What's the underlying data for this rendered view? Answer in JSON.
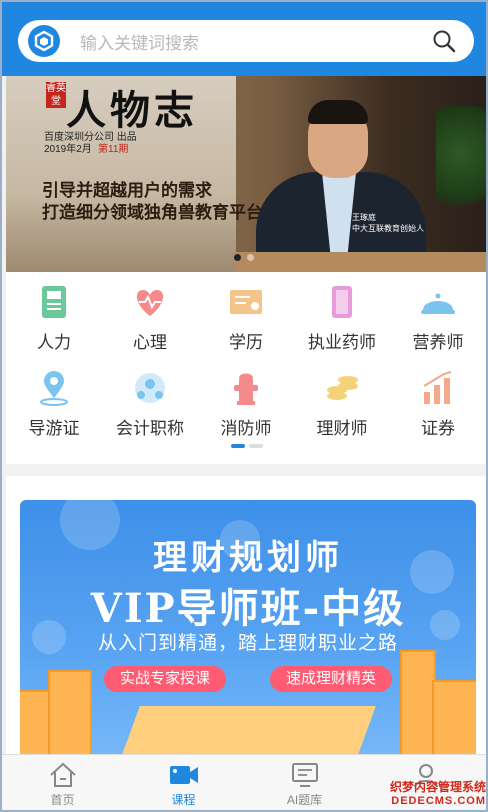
{
  "search": {
    "placeholder": "输入关键词搜索"
  },
  "banner": {
    "badge": "睿英堂",
    "brand": "人物志",
    "org": "百度深圳分公司 出品",
    "date": "2019年2月",
    "issue": "第11期",
    "slogan_line1": "引导并超越用户的需求",
    "slogan_line2": "打造细分领域独角兽教育平台",
    "person_name": "王琢庭",
    "person_title": "中大互联教育创始人",
    "slide_count": 2,
    "active_slide": 1
  },
  "categories": [
    {
      "label": "人力",
      "icon": "hr-book-icon",
      "color": "#6cc79a"
    },
    {
      "label": "心理",
      "icon": "heartbeat-icon",
      "color": "#f58a8a"
    },
    {
      "label": "学历",
      "icon": "certificate-icon",
      "color": "#f4c48a"
    },
    {
      "label": "执业药师",
      "icon": "medicine-box-icon",
      "color": "#e99ad8"
    },
    {
      "label": "营养师",
      "icon": "food-cover-icon",
      "color": "#7cc4f0"
    },
    {
      "label": "导游证",
      "icon": "location-pin-icon",
      "color": "#7cc4f0"
    },
    {
      "label": "会计职称",
      "icon": "network-icon",
      "color": "#7cc4f0"
    },
    {
      "label": "消防师",
      "icon": "fire-hydrant-icon",
      "color": "#f58a8a"
    },
    {
      "label": "理财师",
      "icon": "coins-icon",
      "color": "#f4d27a"
    },
    {
      "label": "证券",
      "icon": "bar-chart-icon",
      "color": "#f4a98a"
    }
  ],
  "category_pager": {
    "pages": 2,
    "active": 1
  },
  "promo": {
    "title": "理财规划师",
    "subtitle": "VIP导师班-中级",
    "tagline": "从入门到精通，踏上理财职业之路",
    "pill_left": "实战专家授课",
    "pill_right": "速成理财精英"
  },
  "tabbar": {
    "items": [
      {
        "label": "首页",
        "icon": "home-icon",
        "active": false
      },
      {
        "label": "课程",
        "icon": "video-icon",
        "active": true
      },
      {
        "label": "AI题库",
        "icon": "monitor-icon",
        "active": false
      },
      {
        "label": "",
        "icon": "user-icon",
        "active": false
      }
    ]
  },
  "watermark": {
    "cn": "织梦内容管理系统",
    "en": "DEDECMS.COM"
  },
  "colors": {
    "primary": "#1f87e0",
    "pill": "#ff5b73"
  }
}
